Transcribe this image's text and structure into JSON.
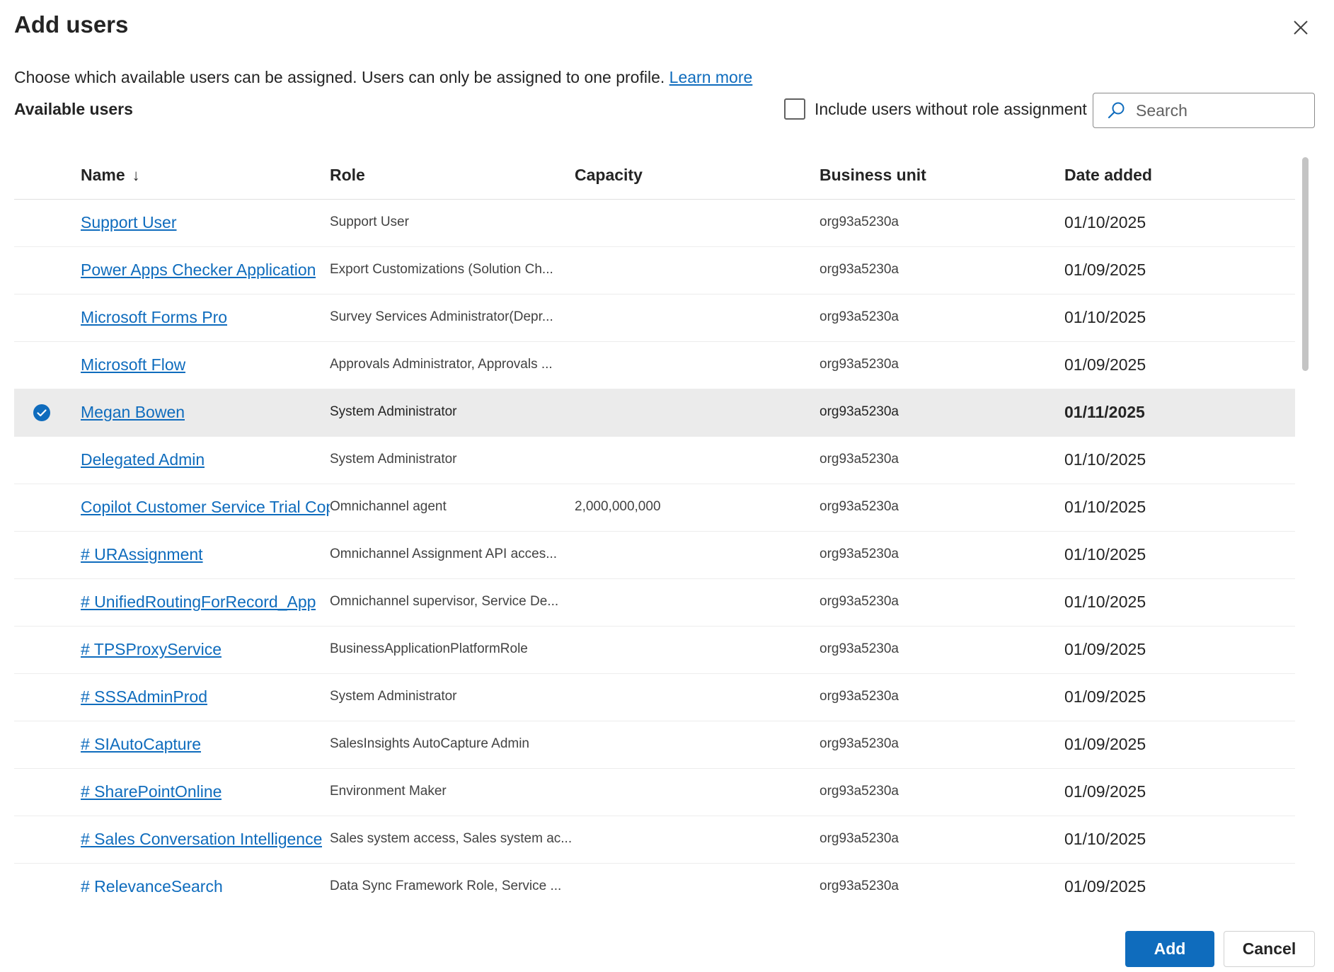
{
  "dialog": {
    "title": "Add users",
    "description": "Choose which available users can be assigned. Users can only be assigned to one profile.",
    "learn_more": "Learn more",
    "section_label": "Available users",
    "include_without_role_label": "Include users without role assignment",
    "include_without_role_checked": false,
    "search_placeholder": "Search",
    "search_value": ""
  },
  "table": {
    "columns": {
      "name": "Name",
      "name_sort": "↓",
      "role": "Role",
      "capacity": "Capacity",
      "business_unit": "Business unit",
      "date_added": "Date added"
    },
    "rows": [
      {
        "name": "Support User",
        "role": "Support User",
        "capacity": "",
        "business_unit": "org93a5230a",
        "date_added": "01/10/2025",
        "selected": false
      },
      {
        "name": "Power Apps Checker Application",
        "role": "Export Customizations (Solution Ch...",
        "capacity": "",
        "business_unit": "org93a5230a",
        "date_added": "01/09/2025",
        "selected": false
      },
      {
        "name": "Microsoft Forms Pro",
        "role": "Survey Services Administrator(Depr...",
        "capacity": "",
        "business_unit": "org93a5230a",
        "date_added": "01/10/2025",
        "selected": false
      },
      {
        "name": "Microsoft Flow",
        "role": "Approvals Administrator, Approvals ...",
        "capacity": "",
        "business_unit": "org93a5230a",
        "date_added": "01/09/2025",
        "selected": false
      },
      {
        "name": "Megan Bowen",
        "role": "System Administrator",
        "capacity": "",
        "business_unit": "org93a5230a",
        "date_added": "01/11/2025",
        "selected": true
      },
      {
        "name": "Delegated Admin",
        "role": "System Administrator",
        "capacity": "",
        "business_unit": "org93a5230a",
        "date_added": "01/10/2025",
        "selected": false
      },
      {
        "name": "Copilot Customer Service Trial Cop",
        "role": "Omnichannel agent",
        "capacity": "2,000,000,000",
        "business_unit": "org93a5230a",
        "date_added": "01/10/2025",
        "selected": false
      },
      {
        "name": "# URAssignment",
        "role": "Omnichannel Assignment API acces...",
        "capacity": "",
        "business_unit": "org93a5230a",
        "date_added": "01/10/2025",
        "selected": false
      },
      {
        "name": "# UnifiedRoutingForRecord_App",
        "role": "Omnichannel supervisor, Service De...",
        "capacity": "",
        "business_unit": "org93a5230a",
        "date_added": "01/10/2025",
        "selected": false
      },
      {
        "name": "# TPSProxyService",
        "role": "BusinessApplicationPlatformRole",
        "capacity": "",
        "business_unit": "org93a5230a",
        "date_added": "01/09/2025",
        "selected": false
      },
      {
        "name": "# SSSAdminProd",
        "role": "System Administrator",
        "capacity": "",
        "business_unit": "org93a5230a",
        "date_added": "01/09/2025",
        "selected": false
      },
      {
        "name": "# SIAutoCapture",
        "role": "SalesInsights AutoCapture Admin",
        "capacity": "",
        "business_unit": "org93a5230a",
        "date_added": "01/09/2025",
        "selected": false
      },
      {
        "name": "# SharePointOnline",
        "role": "Environment Maker",
        "capacity": "",
        "business_unit": "org93a5230a",
        "date_added": "01/09/2025",
        "selected": false
      },
      {
        "name": "# Sales Conversation Intelligence",
        "role": "Sales system access, Sales system ac...",
        "capacity": "",
        "business_unit": "org93a5230a",
        "date_added": "01/10/2025",
        "selected": false
      },
      {
        "name": "# RelevanceSearch",
        "role": "Data Sync Framework Role, Service ...",
        "capacity": "",
        "business_unit": "org93a5230a",
        "date_added": "01/09/2025",
        "selected": false
      }
    ]
  },
  "footer": {
    "add_label": "Add",
    "cancel_label": "Cancel"
  },
  "colors": {
    "accent": "#0f6cbd",
    "selected_row": "#ebebeb",
    "text": "#242424"
  },
  "icons": {
    "close": "close-icon",
    "search": "search-icon",
    "row_selected": "checkmark-circle-icon"
  }
}
